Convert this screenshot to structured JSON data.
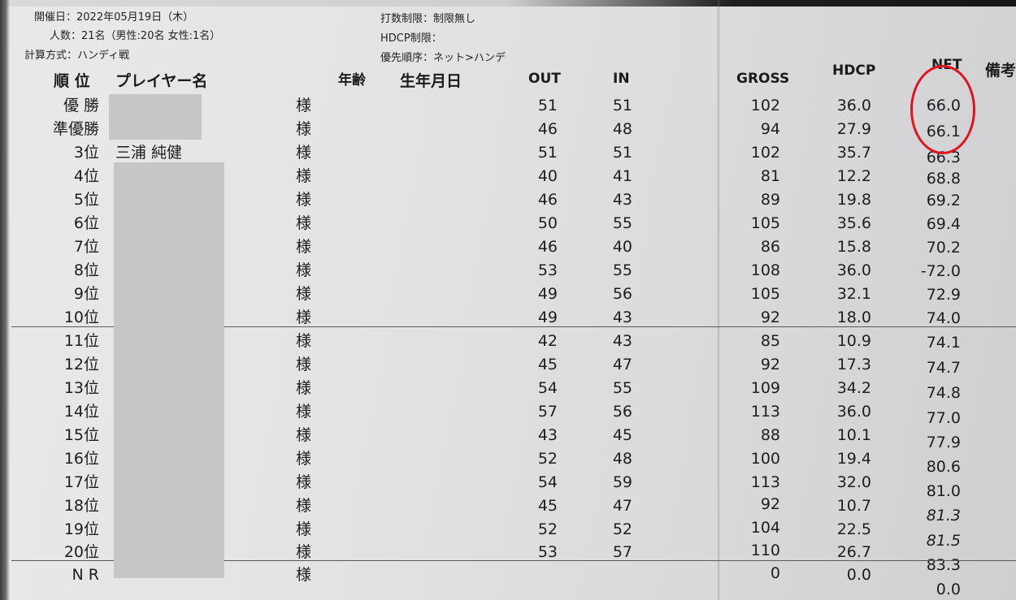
{
  "meta": {
    "date": "開催日：2022年05月19日（木）",
    "people": "人数：21名（男性:20名 女性:1名）",
    "method": "計算方式：ハンディ戦",
    "stroke_limit": "打数制限：制限無し",
    "hdcp_limit": "HDCP制限：",
    "priority": "優先順序：ネット>ハンデ"
  },
  "headers": {
    "rank": "順 位",
    "player": "プレイヤー名",
    "age": "年齢",
    "birth": "生年月日",
    "out": "OUT",
    "in": "IN",
    "gross": "GROSS",
    "hdcp": "HDCP",
    "net": "NET",
    "remarks": "備考"
  },
  "honorific": "様",
  "rows": [
    {
      "rank": "優 勝",
      "name": "",
      "out": "51",
      "in": "51",
      "gross": "102",
      "hdcp": "36.0",
      "net": "66.0"
    },
    {
      "rank": "準優勝",
      "name": "",
      "out": "46",
      "in": "48",
      "gross": "94",
      "hdcp": "27.9",
      "net": "66.1"
    },
    {
      "rank": "3位",
      "name": "三浦 純健",
      "out": "51",
      "in": "51",
      "gross": "102",
      "hdcp": "35.7",
      "net": "66.3"
    },
    {
      "rank": "4位",
      "name": "",
      "out": "40",
      "in": "41",
      "gross": "81",
      "hdcp": "12.2",
      "net": "68.8"
    },
    {
      "rank": "5位",
      "name": "",
      "out": "46",
      "in": "43",
      "gross": "89",
      "hdcp": "19.8",
      "net": "69.2"
    },
    {
      "rank": "6位",
      "name": "",
      "out": "50",
      "in": "55",
      "gross": "105",
      "hdcp": "35.6",
      "net": "69.4"
    },
    {
      "rank": "7位",
      "name": "",
      "out": "46",
      "in": "40",
      "gross": "86",
      "hdcp": "15.8",
      "net": "70.2"
    },
    {
      "rank": "8位",
      "name": "",
      "out": "53",
      "in": "55",
      "gross": "108",
      "hdcp": "36.0",
      "net": "-72.0"
    },
    {
      "rank": "9位",
      "name": "",
      "out": "49",
      "in": "56",
      "gross": "105",
      "hdcp": "32.1",
      "net": "72.9"
    },
    {
      "rank": "10位",
      "name": "",
      "out": "49",
      "in": "43",
      "gross": "92",
      "hdcp": "18.0",
      "net": "74.0"
    },
    {
      "rank": "11位",
      "name": "",
      "out": "42",
      "in": "43",
      "gross": "85",
      "hdcp": "10.9",
      "net": "74.1"
    },
    {
      "rank": "12位",
      "name": "",
      "out": "45",
      "in": "47",
      "gross": "92",
      "hdcp": "17.3",
      "net": "74.7"
    },
    {
      "rank": "13位",
      "name": "",
      "out": "54",
      "in": "55",
      "gross": "109",
      "hdcp": "34.2",
      "net": "74.8"
    },
    {
      "rank": "14位",
      "name": "",
      "out": "57",
      "in": "56",
      "gross": "113",
      "hdcp": "36.0",
      "net": "77.0"
    },
    {
      "rank": "15位",
      "name": "",
      "out": "43",
      "in": "45",
      "gross": "88",
      "hdcp": "10.1",
      "net": "77.9"
    },
    {
      "rank": "16位",
      "name": "",
      "out": "52",
      "in": "48",
      "gross": "100",
      "hdcp": "19.4",
      "net": "80.6"
    },
    {
      "rank": "17位",
      "name": "",
      "out": "54",
      "in": "59",
      "gross": "113",
      "hdcp": "32.0",
      "net": "81.0"
    },
    {
      "rank": "18位",
      "name": "",
      "out": "45",
      "in": "47",
      "gross": "92",
      "hdcp": "10.7",
      "net": "81.3"
    },
    {
      "rank": "19位",
      "name": "",
      "out": "52",
      "in": "52",
      "gross": "104",
      "hdcp": "22.5",
      "net": "81.5"
    },
    {
      "rank": "20位",
      "name": "",
      "out": "53",
      "in": "57",
      "gross": "110",
      "hdcp": "26.7",
      "net": "83.3"
    },
    {
      "rank": "N R",
      "name": "",
      "out": "",
      "in": "",
      "gross": "0",
      "hdcp": "0.0",
      "net": "0.0"
    }
  ],
  "colors": {
    "annotation_circle": "#e0141e",
    "redaction": "#c6c6c8"
  }
}
